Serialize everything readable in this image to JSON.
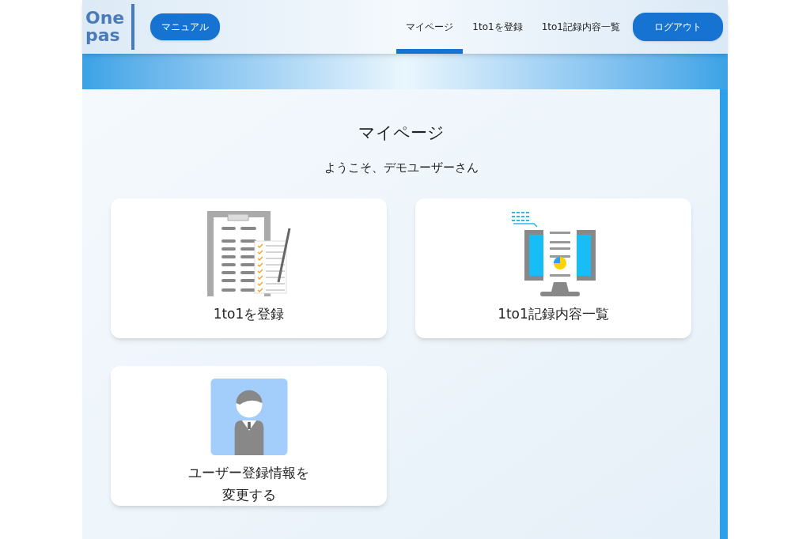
{
  "header": {
    "logo": {
      "lines": [
        "One",
        "pas"
      ]
    },
    "manual_button": "マニュアル",
    "nav": [
      {
        "label": "マイページ",
        "selected": true
      },
      {
        "label": "1to1を登録",
        "selected": false
      },
      {
        "label": "1to1記録内容一覧",
        "selected": false
      }
    ],
    "logout_button": "ログアウト"
  },
  "page": {
    "title": "マイページ",
    "welcome": "ようこそ、デモユーザーさん"
  },
  "cards": [
    {
      "kind": "register",
      "lines": [
        "1to1を登録"
      ]
    },
    {
      "kind": "records",
      "lines": [
        "1to1記録内容一覧"
      ]
    },
    {
      "kind": "user",
      "lines": [
        "ユーザー登録情報を",
        "変更する"
      ]
    }
  ]
}
